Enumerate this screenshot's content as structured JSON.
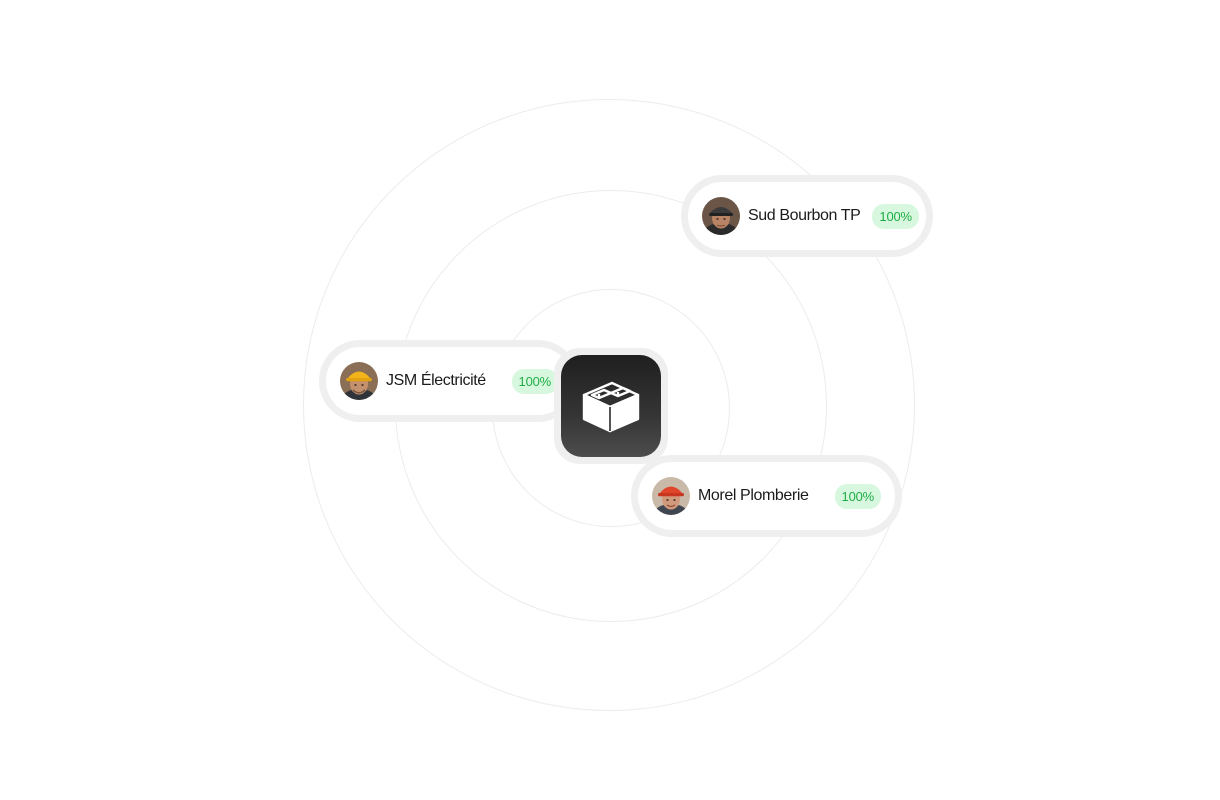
{
  "center_icon": {
    "name": "concrete-block-icon",
    "bg_color": "#2a2a2a"
  },
  "contractors": [
    {
      "name": "Sud Bourbon TP",
      "progress_label": "100%",
      "progress": 1.0,
      "avatar": "worker-avatar-dark-cap"
    },
    {
      "name": "JSM Électricité",
      "progress_label": "100%",
      "progress": 1.0,
      "avatar": "worker-avatar-yellow-helmet"
    },
    {
      "name": "Morel Plomberie",
      "progress_label": "100%",
      "progress": 1.0,
      "avatar": "worker-avatar-red-helmet"
    }
  ],
  "colors": {
    "badge_bg": "#d7f8df",
    "badge_text": "#1fae45",
    "ring": "#ececec"
  }
}
